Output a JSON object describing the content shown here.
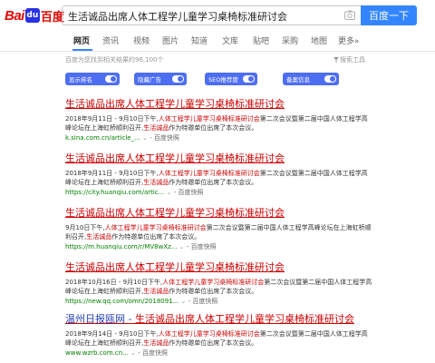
{
  "header": {
    "logo_bai": "Bai",
    "logo_paw": "du",
    "logo_du": "百度",
    "query": "生活诚品出席人体工程学儿童学习桌椅标准研讨会",
    "search_button": "百度一下"
  },
  "tabs": [
    {
      "label": "网页"
    },
    {
      "label": "资讯"
    },
    {
      "label": "视频"
    },
    {
      "label": "图片"
    },
    {
      "label": "知道"
    },
    {
      "label": "文库"
    },
    {
      "label": "贴吧"
    },
    {
      "label": "采购"
    },
    {
      "label": "地图"
    },
    {
      "label": "更多»"
    }
  ],
  "info": {
    "count_text": "百度为您找到相关结果约96,100个",
    "tools": "搜索工具"
  },
  "filters": [
    {
      "label": "显示排名"
    },
    {
      "label": "隐藏广告"
    },
    {
      "label": "SEO推荐度"
    },
    {
      "label": "备案信息"
    }
  ],
  "results": [
    {
      "title": "生活诚品出席人体工程学儿童学习桌椅标准研讨会",
      "abs_pre": "2018年9月11日 - 9月10日下午,",
      "abs_red": "人体工程学儿童学习桌椅标准研讨会",
      "abs_mid": "第二次会议暨第二届中国人体工程学高峰论坛在上海虹桥顺利召开,",
      "abs_red2": "生活诚品",
      "abs_post": "作为特邀单位出席了本次会议。",
      "url": "k.sina.com.cn/article_...",
      "snapshot": "- 百度快照"
    },
    {
      "title": "生活诚品出席人体工程学儿童学习桌椅标准研讨会",
      "abs_pre": "2018年9月11日 - 9月10日下午,",
      "abs_red": "人体工程学儿童学习桌椅标准研讨会",
      "abs_mid": "第二次会议暨第二届中国人体工程学高峰论坛在上海虹桥顺利召开,",
      "abs_red2": "生活诚品",
      "abs_post": "作为特邀单位出席了本次会议。",
      "url": "https://city.huanqiu.com/artic...",
      "snapshot": "- 百度快照"
    },
    {
      "title": "生活诚品出席人体工程学儿童学习桌椅标准研讨会",
      "abs_pre": "9月10日下午,",
      "abs_red": "人体工程学儿童学习桌椅标准研讨会",
      "abs_mid": "第二次会议暨第二届中国人体工程学高峰论坛在上海虹桥顺利召开,",
      "abs_red2": "生活诚品",
      "abs_post": "作为特邀单位出席了本次会议。",
      "url": "https://m.huanqiu.com/r/MV8wXz...",
      "snapshot": "- 百度快照"
    },
    {
      "title": "生活诚品出席人体工程学儿童学习桌椅标准研讨会",
      "abs_pre": "2018年10月16日 - 9月10日下午,",
      "abs_red": "人体工程学儿童学习桌椅标准研讨会",
      "abs_mid": "第二次会议暨第二届中国人体工程学高峰论坛在上海虹桥顺利召开,",
      "abs_red2": "生活诚品",
      "abs_post": "作为特邀单位出席了本次会议。",
      "url": "https://new.qq.com/omn/2018091...",
      "snapshot": "- 百度快照"
    },
    {
      "title_blue": "温州日报瓯网 - ",
      "title": "生活诚品出席人体工程学儿童学习桌椅标准研讨会",
      "abs_pre": "2018年9月14日 - 9月10日下午,",
      "abs_red": "人体工程学儿童学习桌椅标准研讨会",
      "abs_mid": "第二次会议暨第二届中国人体工程学高峰论坛在上海虹桥顺利召开,",
      "abs_red2": "生活诚品",
      "abs_post": "作为特邀单位出席了本次会议。",
      "url": "www.wzrb.com.cn...",
      "snapshot": "- 百度快照"
    }
  ]
}
